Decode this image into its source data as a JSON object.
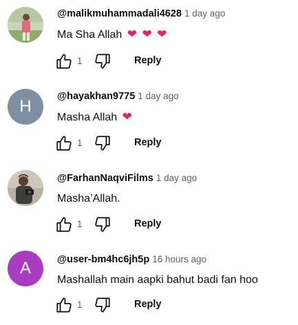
{
  "comments": [
    {
      "author": "@malikmuhammadali4628",
      "time": "1 day ago",
      "text": "Ma Sha Allah",
      "hearts": [
        "❤",
        "❤",
        "❤"
      ],
      "likes": "1",
      "reply_label": "Reply",
      "avatar_type": "photo"
    },
    {
      "author": "@hayakhan9775",
      "time": "1 day ago",
      "text": "Masha Allah",
      "hearts": [
        "❤"
      ],
      "likes": "1",
      "reply_label": "Reply",
      "avatar_letter": "H",
      "avatar_color": "#7d8fa0"
    },
    {
      "author": "@FarhanNaqviFilms",
      "time": "1 day ago",
      "text": "Masha’Allah.",
      "likes": "1",
      "reply_label": "Reply",
      "avatar_type": "photo"
    },
    {
      "author": "@user-bm4hc6jh5p",
      "time": "16 hours ago",
      "text": "Mashallah main aapki bahut badi fan hoo",
      "likes": "1",
      "reply_label": "Reply",
      "avatar_letter": "A",
      "avatar_color": "#a93cc0"
    }
  ]
}
